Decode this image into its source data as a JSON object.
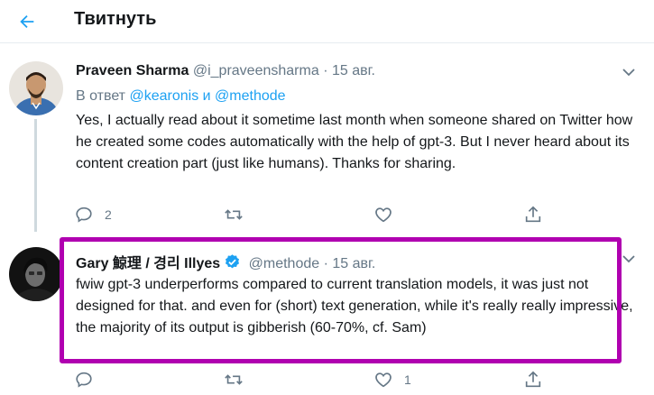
{
  "header": {
    "title": "Твитнуть"
  },
  "tweets": [
    {
      "author": "Praveen Sharma",
      "handle": "@i_praveensharma",
      "separator": "·",
      "date": "15 авг.",
      "replying_prefix": "В ответ",
      "replying_user1": "@kearonis",
      "replying_and": "и",
      "replying_user2": "@methode",
      "text": "Yes, I actually read about it sometime last month when someone shared on Twitter how he created some codes automatically with the help of gpt-3. But I never heard about its content creation part (just like humans). Thanks for sharing.",
      "reply_count": "2",
      "retweet_count": "",
      "like_count": ""
    },
    {
      "author": "Gary 鯨理 / 경리 Illyes",
      "handle": "@methode",
      "separator": "·",
      "date": "15 авг.",
      "text": "fwiw gpt-3 underperforms compared to current translation models, it was just not designed for that. and even for (short) text generation, while it's really really impressive, the majority of its output is gibberish (60-70%, cf. Sam)",
      "reply_count": "",
      "retweet_count": "",
      "like_count": "1"
    }
  ],
  "colors": {
    "accent": "#1da1f2",
    "secondary_text": "#657786",
    "highlight": "#b000b0"
  },
  "icons": [
    "back-arrow-icon",
    "chevron-down-icon",
    "reply-icon",
    "retweet-icon",
    "like-icon",
    "share-icon",
    "verified-badge-icon"
  ]
}
